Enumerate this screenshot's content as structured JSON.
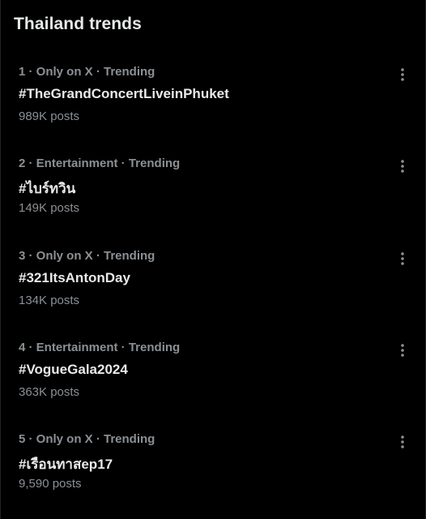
{
  "header": {
    "title": "Thailand trends"
  },
  "trends": [
    {
      "meta": "1 · Only on X · Trending",
      "name": "#TheGrandConcertLiveinPhuket",
      "posts": "989K posts"
    },
    {
      "meta": "2 · Entertainment · Trending",
      "name": "#ไบร์ทวิน",
      "posts": "149K posts"
    },
    {
      "meta": "3 · Only on X · Trending",
      "name": "#321ItsAntonDay",
      "posts": "134K posts"
    },
    {
      "meta": "4 · Entertainment · Trending",
      "name": "#VogueGala2024",
      "posts": "363K posts"
    },
    {
      "meta": "5 · Only on X · Trending",
      "name": "#เรือนทาสep17",
      "posts": "9,590 posts"
    }
  ],
  "icons": {
    "more": "more-vertical-icon"
  },
  "colors": {
    "background": "#000000",
    "primary_text": "#e7e9ea",
    "secondary_text": "#8b9095"
  }
}
